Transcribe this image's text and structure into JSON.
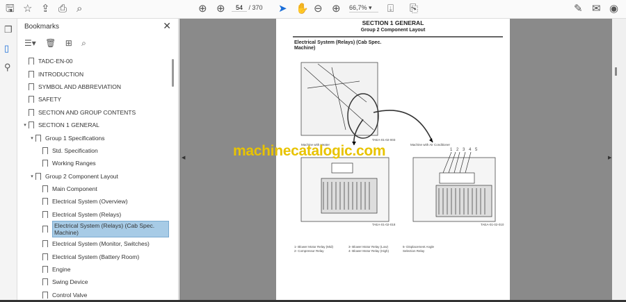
{
  "toolbar": {
    "page_current": "54",
    "page_total": "/ 370",
    "zoom": "66,7%"
  },
  "bookmarks": {
    "title": "Bookmarks",
    "items": [
      {
        "label": "TADC-EN-00",
        "level": 0,
        "toggle": ""
      },
      {
        "label": "INTRODUCTION",
        "level": 0,
        "toggle": ""
      },
      {
        "label": "SYMBOL AND ABBREVIATION",
        "level": 0,
        "toggle": ""
      },
      {
        "label": "SAFETY",
        "level": 0,
        "toggle": ""
      },
      {
        "label": "SECTION AND GROUP CONTENTS",
        "level": 0,
        "toggle": ""
      },
      {
        "label": "SECTION 1 GENERAL",
        "level": 0,
        "toggle": "▾"
      },
      {
        "label": "Group 1 Specifications",
        "level": 1,
        "toggle": "▾"
      },
      {
        "label": "Std. Specification",
        "level": 2,
        "toggle": ""
      },
      {
        "label": "Working Ranges",
        "level": 2,
        "toggle": ""
      },
      {
        "label": "Group 2 Component Layout",
        "level": 1,
        "toggle": "▾"
      },
      {
        "label": "Main Component",
        "level": 2,
        "toggle": ""
      },
      {
        "label": "Electrical System (Overview)",
        "level": 2,
        "toggle": ""
      },
      {
        "label": "Electrical System (Relays)",
        "level": 2,
        "toggle": ""
      },
      {
        "label": "Electrical System (Relays) (Cab Spec. Machine)",
        "level": 2,
        "toggle": "",
        "selected": true
      },
      {
        "label": "Electrical System (Monitor, Switches)",
        "level": 2,
        "toggle": ""
      },
      {
        "label": "Electrical System (Battery Room)",
        "level": 2,
        "toggle": ""
      },
      {
        "label": "Engine",
        "level": 2,
        "toggle": ""
      },
      {
        "label": "Swing Device",
        "level": 2,
        "toggle": ""
      },
      {
        "label": "Control Valve",
        "level": 2,
        "toggle": ""
      }
    ]
  },
  "document": {
    "section": "SECTION 1 GENERAL",
    "group": "Group 2 Component Layout",
    "title": "Electrical System (Relays) (Cab Spec. Machine)",
    "fig_top_code": "TAEA-01-02-003",
    "heater_label": "Machine with Heater",
    "ac_label": "Machine with Air Conditioner",
    "fig_left_code": "TAEA-01-02-018",
    "fig_right_code": "TAEA-01-02-010",
    "numbers": "1 2 3 4 5",
    "legend": [
      "1-  Blower Motor Relay (Mid)",
      "2-  Compressor Relay",
      "3-  Blower Motor Relay (Low)",
      "4-  Blower Motor Relay (High)",
      "5-  Displacement Angle Selection Relay"
    ]
  },
  "watermark": "machinecatalogic.com"
}
